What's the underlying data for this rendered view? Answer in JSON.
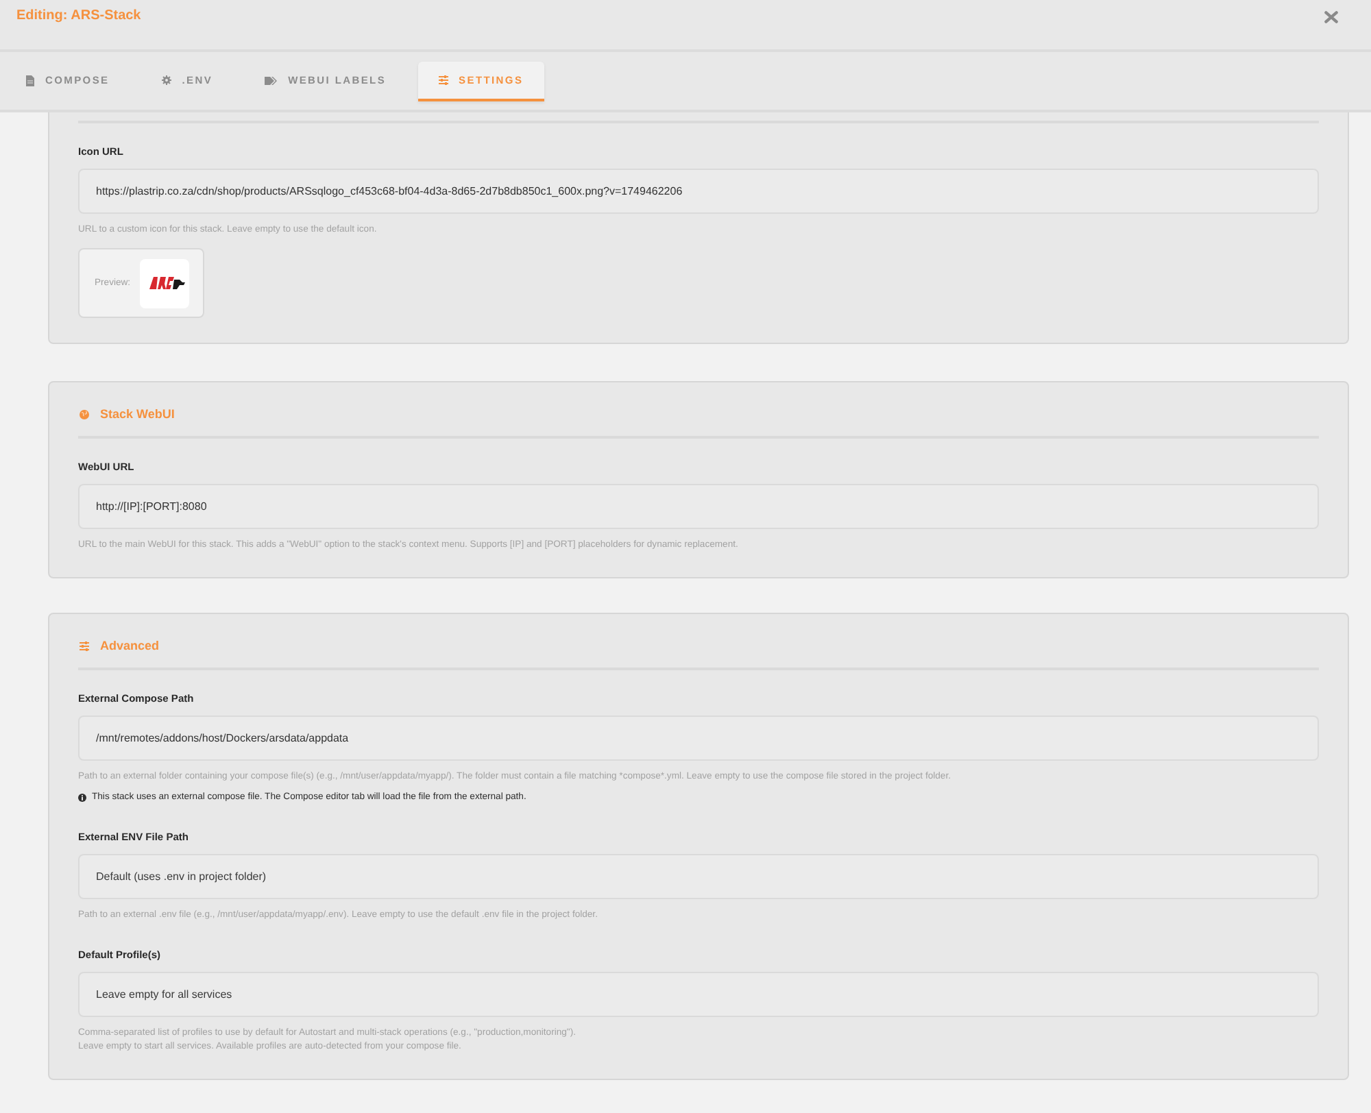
{
  "window": {
    "title": "Editing: ARS-Stack"
  },
  "tabs": [
    {
      "label": "COMPOSE",
      "selected": false
    },
    {
      "label": ".ENV",
      "selected": false
    },
    {
      "label": "WEBUI LABELS",
      "selected": false
    },
    {
      "label": "SETTINGS",
      "selected": true
    }
  ],
  "sections": [
    {
      "fields": [
        {
          "label": "Icon URL",
          "value": "https://plastrip.co.za/cdn/shop/products/ARSsqlogo_cf453c68-bf04-4d3a-8d65-2d7b8db850c1_600x.png?v=1749462206",
          "help": "URL to a custom icon for this stack. Leave empty to use the default icon.",
          "preview": {
            "label": "Preview:"
          }
        }
      ]
    },
    {
      "title": "Stack WebUI",
      "fields": [
        {
          "label": "WebUI URL",
          "value": "http://[IP]:[PORT]:8080",
          "help": "URL to the main WebUI for this stack. This adds a \"WebUI\" option to the stack's context menu. Supports [IP] and [PORT] placeholders for dynamic replacement."
        }
      ]
    },
    {
      "title": "Advanced",
      "fields": [
        {
          "label": "External Compose Path",
          "value": "/mnt/remotes/addons/host/Dockers/arsdata/appdata",
          "help": "Path to an external folder containing your compose file(s) (e.g., /mnt/user/appdata/myapp/). The folder must contain a file matching *compose*.yml. Leave empty to use the compose file stored in the project folder.",
          "note": "This stack uses an external compose file. The Compose editor tab will load the file from the external path."
        },
        {
          "label": "External ENV File Path",
          "placeholder": "Default (uses .env in project folder)",
          "help": "Path to an external .env file (e.g., /mnt/user/appdata/myapp/.env). Leave empty to use the default .env file in the project folder."
        },
        {
          "label": "Default Profile(s)",
          "placeholder": "Leave empty for all services",
          "help": "Comma-separated list of profiles to use by default for Autostart and multi-stack operations (e.g., \"production,monitoring\").\nLeave empty to start all services. Available profiles are auto-detected from your compose file."
        }
      ]
    }
  ]
}
